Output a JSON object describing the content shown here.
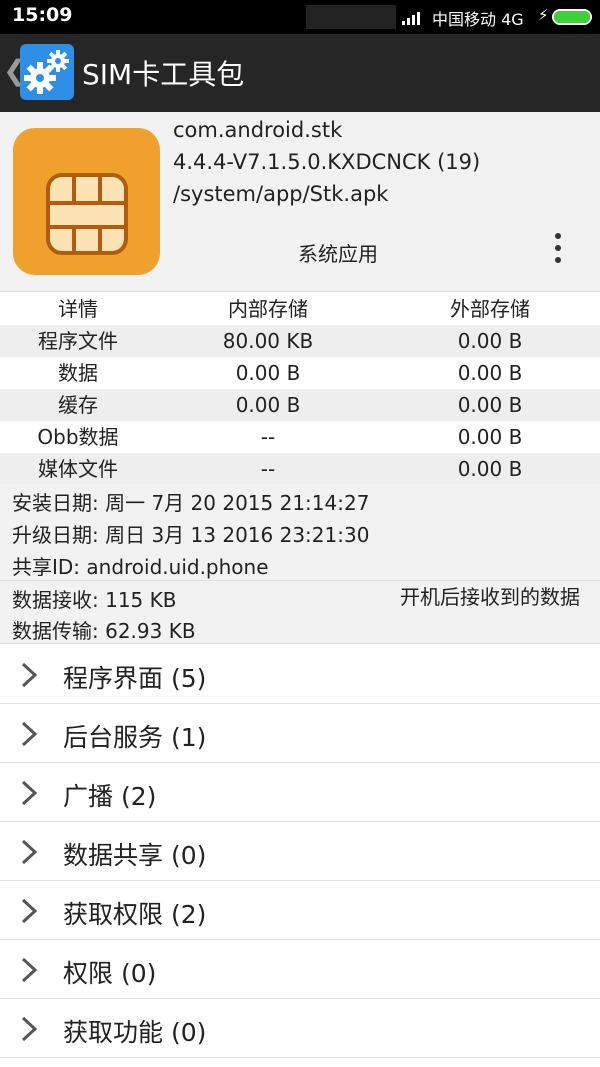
{
  "status_bar": {
    "time": "15:09",
    "carrier": "中国移动 4G",
    "battery_level": 1.0,
    "battery_color": "#3fd13a",
    "icons": [
      "signal-icon",
      "charging-icon",
      "battery-icon"
    ]
  },
  "app_bar": {
    "title": "SIM卡工具包",
    "back_glyph": "❮",
    "icon": "gears-icon",
    "icon_color": "#2f8fe6"
  },
  "package": {
    "name": "com.android.stk",
    "version": "4.4.4-V7.1.5.0.KXDCNCK (19)",
    "path": "/system/app/Stk.apk",
    "type": "系统应用",
    "icon": "sim-card-icon",
    "icon_color": "#f0a02c"
  },
  "storage_table": {
    "headers": [
      "详情",
      "内部存储",
      "外部存储"
    ],
    "rows": [
      [
        "程序文件",
        "80.00 KB",
        "0.00 B"
      ],
      [
        "数据",
        "0.00 B",
        "0.00 B"
      ],
      [
        "缓存",
        "0.00 B",
        "0.00 B"
      ],
      [
        "Obb数据",
        "--",
        "0.00 B"
      ],
      [
        "媒体文件",
        "--",
        "0.00 B"
      ]
    ]
  },
  "info": {
    "install_date": "安装日期: 周一 7月 20 2015 21:14:27",
    "update_date": "升级日期: 周日 3月 13 2016 23:21:30",
    "shared_id": "共享ID: android.uid.phone"
  },
  "traffic": {
    "received": "数据接收: 115 KB",
    "sent": "数据传输: 62.93 KB",
    "note": "开机后接收到的数据"
  },
  "sections": [
    {
      "label": "程序界面 (5)"
    },
    {
      "label": "后台服务 (1)"
    },
    {
      "label": "广播 (2)"
    },
    {
      "label": "数据共享 (0)"
    },
    {
      "label": "获取权限 (2)"
    },
    {
      "label": "权限 (0)"
    },
    {
      "label": "获取功能 (0)"
    }
  ]
}
